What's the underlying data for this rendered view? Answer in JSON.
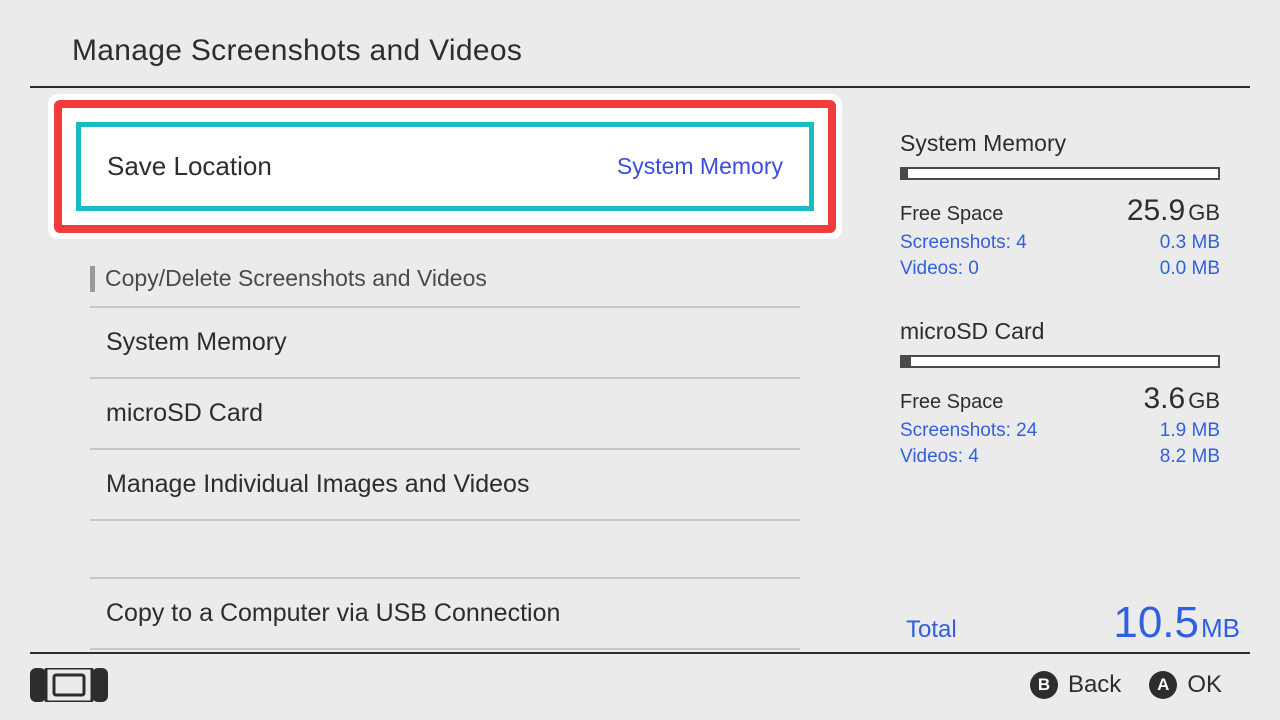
{
  "header": {
    "title": "Manage Screenshots and Videos"
  },
  "save_location": {
    "label": "Save Location",
    "value": "System Memory"
  },
  "section_header": "Copy/Delete Screenshots and Videos",
  "rows": {
    "system_memory": "System Memory",
    "microsd": "microSD Card",
    "manage_individual": "Manage Individual Images and Videos",
    "copy_usb": "Copy to a Computer via USB Connection"
  },
  "side": {
    "sysmem": {
      "title": "System Memory",
      "free_label": "Free Space",
      "free_value": "25.9",
      "free_unit": "GB",
      "screenshots_label": "Screenshots: 4",
      "screenshots_size": "0.3 MB",
      "videos_label": "Videos: 0",
      "videos_size": "0.0 MB",
      "bar_pct": 2
    },
    "sd": {
      "title": "microSD Card",
      "free_label": "Free Space",
      "free_value": "3.6",
      "free_unit": "GB",
      "screenshots_label": "Screenshots: 24",
      "screenshots_size": "1.9 MB",
      "videos_label": "Videos: 4",
      "videos_size": "8.2 MB",
      "bar_pct": 3
    },
    "total_label": "Total",
    "total_value": "10.5",
    "total_unit": "MB"
  },
  "footer": {
    "back_letter": "B",
    "back_label": "Back",
    "ok_letter": "A",
    "ok_label": "OK"
  }
}
